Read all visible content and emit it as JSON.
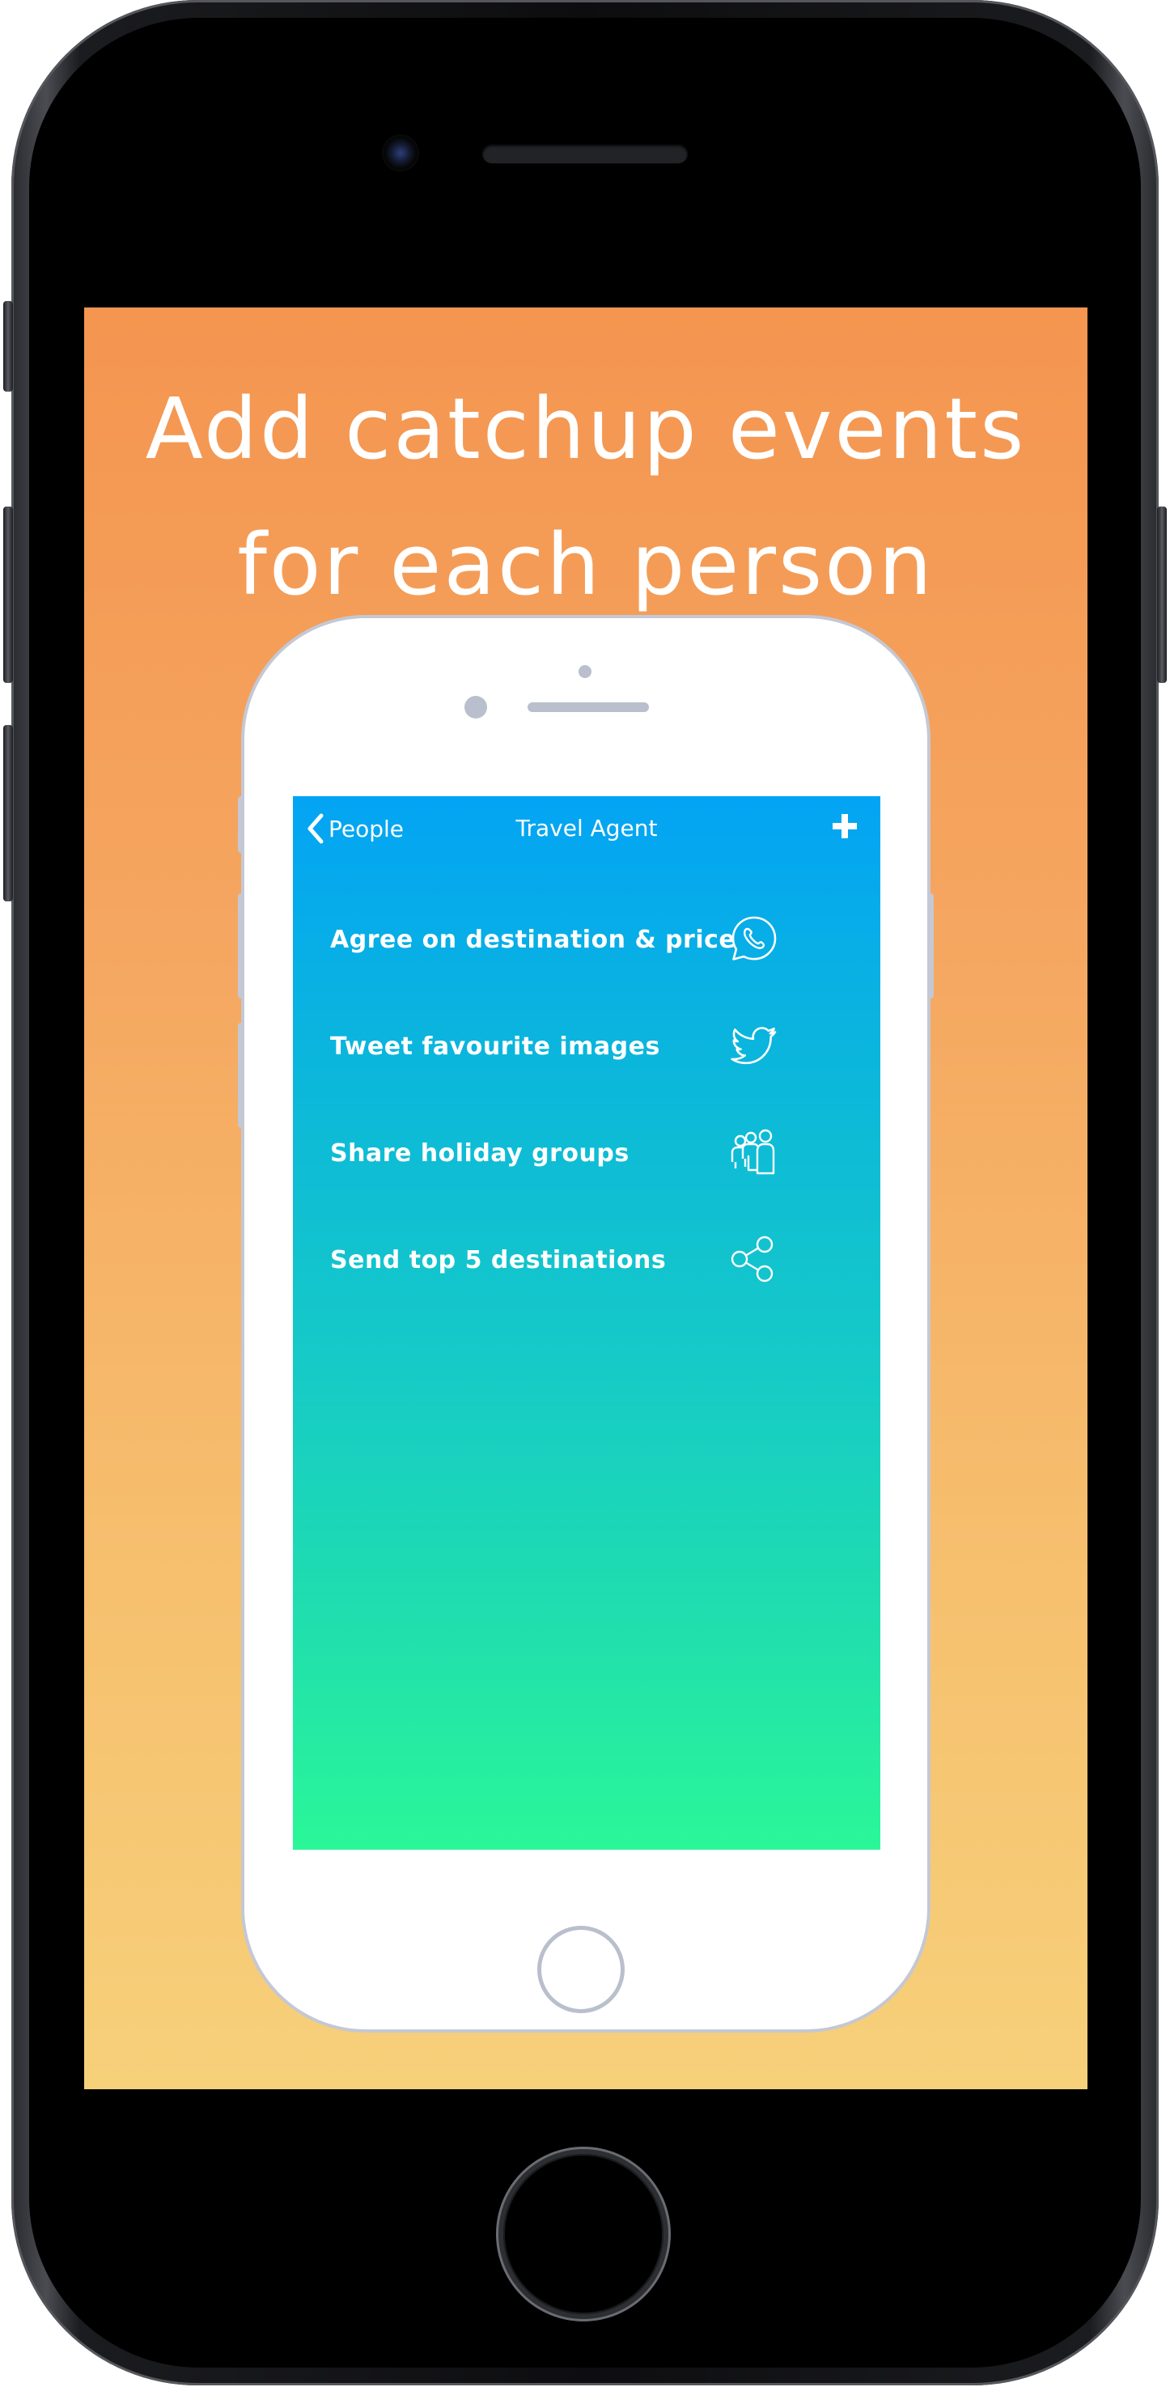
{
  "promo": {
    "headline_line1": "Add catchup events",
    "headline_line2": "for each person"
  },
  "app": {
    "nav": {
      "back_label": "People",
      "title": "Travel Agent",
      "add_icon": "plus-icon",
      "back_icon": "chevron-left-icon"
    },
    "events": [
      {
        "label": "Agree on destination & price",
        "icon": "whatsapp-icon"
      },
      {
        "label": "Tweet favourite images",
        "icon": "twitter-icon"
      },
      {
        "label": "Share holiday groups",
        "icon": "group-icon"
      },
      {
        "label": "Send top 5 destinations",
        "icon": "share-icon"
      }
    ]
  },
  "colors": {
    "background_top": "#f49550",
    "background_bottom": "#f7d07a",
    "app_gradient_top": "#03a4f4",
    "app_gradient_bottom": "#2af798",
    "text": "#ffffff"
  }
}
